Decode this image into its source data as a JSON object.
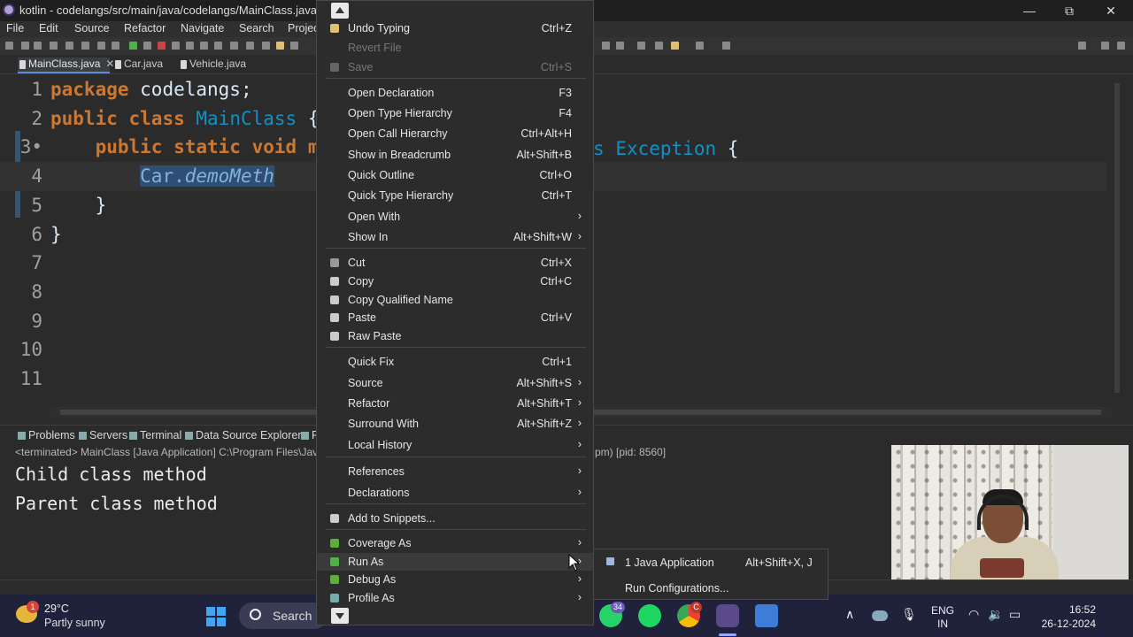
{
  "window": {
    "title": "kotlin - codelangs/src/main/java/codelangs/MainClass.java - Ecl",
    "minimize": "—",
    "restore": "⧉",
    "close": "✕"
  },
  "menubar": [
    "File",
    "Edit",
    "Source",
    "Refactor",
    "Navigate",
    "Search",
    "Projec"
  ],
  "tabs": [
    {
      "label": "MainClass.java",
      "close": "✕"
    },
    {
      "label": "Car.java"
    },
    {
      "label": "Vehicle.java"
    }
  ],
  "code_lines": [
    {
      "n": "1",
      "parts": [
        {
          "t": "package",
          "c": "kw"
        },
        {
          "t": " codelangs;",
          "c": "plain"
        }
      ]
    },
    {
      "n": "2",
      "parts": [
        {
          "t": "public",
          "c": "kw"
        },
        {
          "t": " ",
          "c": "plain"
        },
        {
          "t": "class",
          "c": "kw"
        },
        {
          "t": " ",
          "c": "plain"
        },
        {
          "t": "MainClass",
          "c": "cls"
        },
        {
          "t": " {",
          "c": "plain"
        }
      ]
    },
    {
      "n": "3•",
      "parts": [
        {
          "t": "    ",
          "c": "plain"
        },
        {
          "t": "public",
          "c": "kw"
        },
        {
          "t": " ",
          "c": "plain"
        },
        {
          "t": "static",
          "c": "kw"
        },
        {
          "t": " ",
          "c": "plain"
        },
        {
          "t": "void",
          "c": "kw"
        },
        {
          "t": " m",
          "c": "kw"
        }
      ]
    },
    {
      "n": "4",
      "parts": [
        {
          "t": "        ",
          "c": "plain"
        },
        {
          "t": "Car.",
          "c": "sel"
        },
        {
          "t": "demoMeth",
          "c": "sel it"
        }
      ]
    },
    {
      "n": "5",
      "parts": [
        {
          "t": "    }",
          "c": "plain"
        }
      ]
    },
    {
      "n": "6",
      "parts": [
        {
          "t": "}",
          "c": "plain"
        }
      ]
    },
    {
      "n": "7",
      "parts": []
    },
    {
      "n": "8",
      "parts": []
    },
    {
      "n": "9",
      "parts": []
    },
    {
      "n": "10",
      "parts": []
    },
    {
      "n": "11",
      "parts": []
    }
  ],
  "line3_tail": {
    "s": "s",
    "exception": "Exception",
    "brace": "{"
  },
  "panel_tabs": [
    "Problems",
    "Servers",
    "Terminal",
    "Data Source Explorer",
    "P"
  ],
  "console_header_left": "<terminated> MainClass [Java Application] C:\\Program Files\\Java",
  "console_header_right": "pm) [pid: 8560]",
  "console_lines": [
    "Child class method",
    "Parent class method"
  ],
  "context_menu": {
    "items": [
      {
        "label": "Undo Typing",
        "shortcut": "Ctrl+Z",
        "icon": "undo-icon",
        "color": "#e0c070"
      },
      {
        "label": "Revert File",
        "shortcut": "",
        "disabled": true
      },
      {
        "label": "Save",
        "shortcut": "Ctrl+S",
        "disabled": true,
        "icon": "save-icon",
        "color": "#666"
      },
      {
        "sep": true
      },
      {
        "label": "Open Declaration",
        "shortcut": "F3"
      },
      {
        "label": "Open Type Hierarchy",
        "shortcut": "F4"
      },
      {
        "label": "Open Call Hierarchy",
        "shortcut": "Ctrl+Alt+H"
      },
      {
        "label": "Show in Breadcrumb",
        "shortcut": "Alt+Shift+B"
      },
      {
        "label": "Quick Outline",
        "shortcut": "Ctrl+O"
      },
      {
        "label": "Quick Type Hierarchy",
        "shortcut": "Ctrl+T"
      },
      {
        "label": "Open With",
        "shortcut": "",
        "submenu": true
      },
      {
        "label": "Show In",
        "shortcut": "Alt+Shift+W",
        "submenu": true
      },
      {
        "sep": true
      },
      {
        "label": "Cut",
        "shortcut": "Ctrl+X",
        "icon": "cut-icon",
        "color": "#999"
      },
      {
        "label": "Copy",
        "shortcut": "Ctrl+C",
        "icon": "copy-icon",
        "color": "#ccc"
      },
      {
        "label": "Copy Qualified Name",
        "shortcut": "",
        "icon": "copy-qualified-icon",
        "color": "#ccc"
      },
      {
        "label": "Paste",
        "shortcut": "Ctrl+V",
        "icon": "paste-icon",
        "color": "#ccc"
      },
      {
        "label": "Raw Paste",
        "shortcut": "",
        "icon": "raw-paste-icon",
        "color": "#ccc"
      },
      {
        "sep": true
      },
      {
        "label": "Quick Fix",
        "shortcut": "Ctrl+1"
      },
      {
        "label": "Source",
        "shortcut": "Alt+Shift+S",
        "submenu": true
      },
      {
        "label": "Refactor",
        "shortcut": "Alt+Shift+T",
        "submenu": true
      },
      {
        "label": "Surround With",
        "shortcut": "Alt+Shift+Z",
        "submenu": true
      },
      {
        "label": "Local History",
        "shortcut": "",
        "submenu": true
      },
      {
        "sep": true
      },
      {
        "label": "References",
        "shortcut": "",
        "submenu": true
      },
      {
        "label": "Declarations",
        "shortcut": "",
        "submenu": true
      },
      {
        "sep": true
      },
      {
        "label": "Add to Snippets...",
        "shortcut": "",
        "icon": "snippet-icon",
        "color": "#ccc"
      },
      {
        "sep": true
      },
      {
        "label": "Coverage As",
        "shortcut": "",
        "submenu": true,
        "icon": "coverage-icon",
        "color": "#5fae3b"
      },
      {
        "label": "Run As",
        "shortcut": "",
        "submenu": true,
        "hover": true,
        "icon": "run-icon",
        "color": "#4fb14a"
      },
      {
        "label": "Debug As",
        "shortcut": "",
        "submenu": true,
        "icon": "debug-icon",
        "color": "#5fae3b"
      },
      {
        "label": "Profile As",
        "shortcut": "",
        "submenu": true,
        "icon": "profile-icon",
        "color": "#7aa"
      }
    ],
    "arrow": "›"
  },
  "run_as_submenu": [
    {
      "label": "1 Java Application",
      "shortcut": "Alt+Shift+X, J",
      "icon": "java-app-icon"
    },
    {
      "label": "Run Configurations...",
      "shortcut": ""
    }
  ],
  "taskbar": {
    "temp": "29°C",
    "condition": "Partly sunny",
    "weather_badge": "1",
    "search": "Search",
    "whatsapp_badge": "34",
    "chrome_badge": "C",
    "lang_top": "ENG",
    "lang_bottom": "IN",
    "time": "16:52",
    "date": "26-12-2024",
    "tray_up": "∧",
    "tray_mic": "🎙",
    "tray_wifi": "◠",
    "tray_vol": "🔉",
    "tray_battery": "▭"
  },
  "colors": {
    "keyword": "#cc7832",
    "class": "#1290c3",
    "selection": "#2f4e73",
    "taskbar": "#20213a"
  }
}
